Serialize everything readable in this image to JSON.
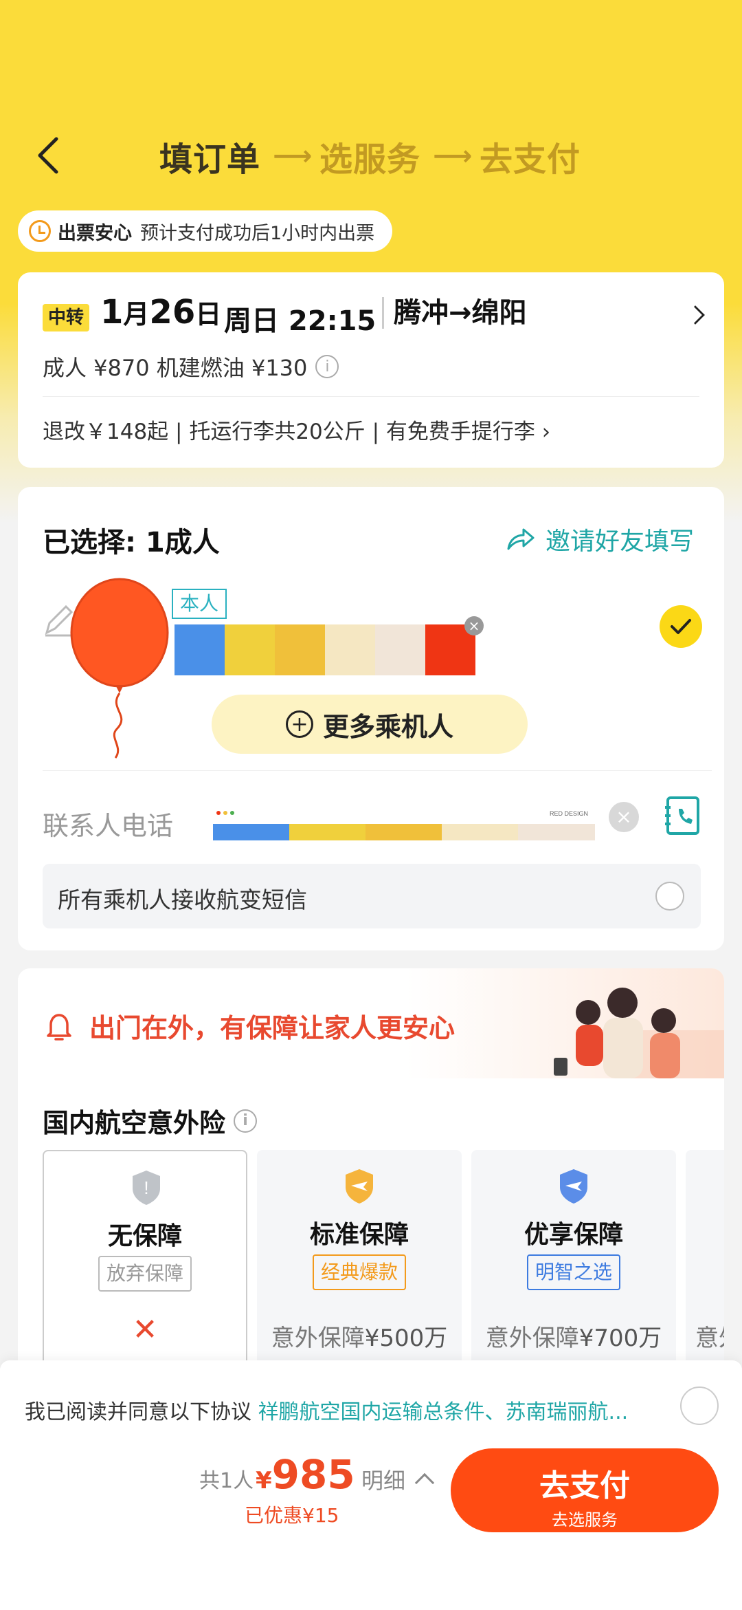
{
  "header": {
    "steps": [
      {
        "label": "填订单",
        "active": true
      },
      {
        "label": "选服务",
        "active": false
      },
      {
        "label": "去支付",
        "active": false
      }
    ]
  },
  "notice": {
    "title": "出票安心",
    "text": "预计支付成功后1小时内出票",
    "icon": "clock-icon"
  },
  "flight": {
    "tag": "中转",
    "month": "1",
    "month_unit": "月",
    "day": "26",
    "day_unit": "日",
    "weekday_time": "周日 22:15",
    "route": "腾冲→绵阳",
    "price_line": "成人 ¥870 机建燃油 ¥130",
    "rules_line": "退改￥148起 | 托运行李共20公斤 | 有免费手提行李 ›"
  },
  "passengers": {
    "selected_label": "已选择: 1成人",
    "invite_label": "邀请好友填写",
    "self_badge": "本人",
    "more_button": "更多乘机人",
    "contact_label": "联系人电话",
    "phone_redaction_caption": "RED DESIGN",
    "sms_label": "所有乘机人接收航变短信",
    "redaction_colors": [
      "#4a90e8",
      "#f0d03c",
      "#f0c03a",
      "#f5e7c2",
      "#f1e5d8",
      "#ef3514"
    ]
  },
  "insurance": {
    "slogan": "出门在外，有保障让家人更安心",
    "section_title": "国内航空意外险",
    "plans": [
      {
        "name": "无保障",
        "badge": "放弃保障",
        "line": "",
        "selected": true,
        "icon": "gray-shield-icon"
      },
      {
        "name": "标准保障",
        "badge": "经典爆款",
        "line_label": "意外保障",
        "line_value": "¥500万",
        "selected": false,
        "icon": "orange-plane-shield-icon"
      },
      {
        "name": "优享保障",
        "badge": "明智之选",
        "line_label": "意外保障",
        "line_value": "¥700万",
        "selected": false,
        "icon": "blue-plane-shield-icon"
      },
      {
        "name": "",
        "badge": "",
        "line_label": "意外",
        "line_value": "",
        "selected": false,
        "icon": ""
      }
    ]
  },
  "bottom": {
    "agree_prefix": "我已阅读并同意以下协议 ",
    "agree_link": "祥鹏航空国内运输总条件、苏南瑞丽航...",
    "count": "共1人",
    "currency": "¥",
    "total": "985",
    "saved": "已优惠¥15",
    "detail": "明细",
    "pay_label": "去支付",
    "pay_sub": "去选服务"
  },
  "colors": {
    "brand_yellow": "#fbdc3a",
    "accent_orange": "#ff4b12",
    "link_teal": "#1fa6a6"
  }
}
